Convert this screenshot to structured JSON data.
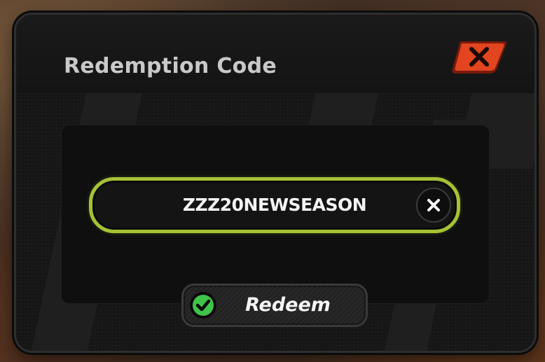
{
  "dialog": {
    "title": "Redemption Code",
    "close_icon": "close-x-icon"
  },
  "code_input": {
    "value": "ZZZ20NEWSEASON",
    "clear_icon": "clear-x-icon",
    "accent_color": "#a5c234"
  },
  "redeem_button": {
    "label": "Redeem",
    "icon": "check-circle-icon",
    "icon_color": "#3fc34a"
  },
  "close_button": {
    "color": "#e2451f"
  }
}
